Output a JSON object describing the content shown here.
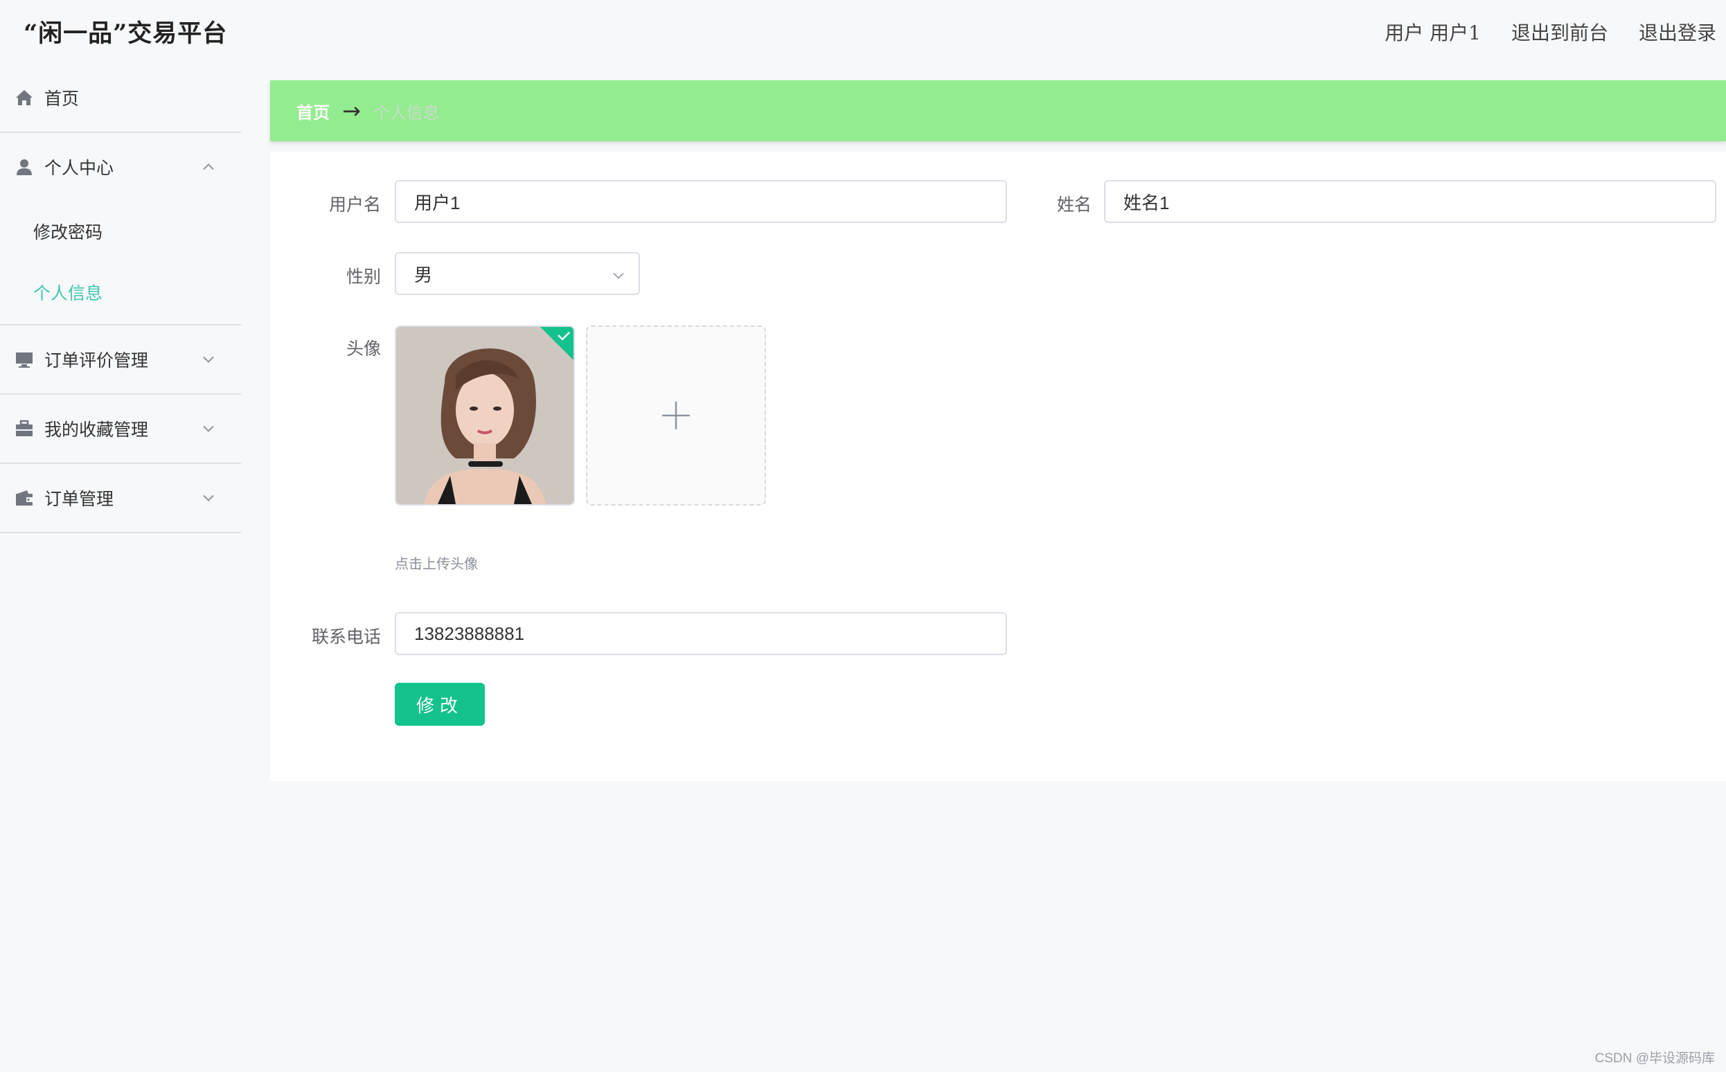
{
  "header": {
    "app_title": "“闲一品”交易平台",
    "user_prefix": "用户",
    "user_name": "用户1",
    "back_to_front": "退出到前台",
    "logout": "退出登录"
  },
  "sidebar": {
    "items": [
      {
        "label": "首页",
        "icon": "home-icon"
      },
      {
        "label": "个人中心",
        "icon": "user-icon",
        "expanded": true,
        "children": [
          {
            "label": "修改密码"
          },
          {
            "label": "个人信息",
            "active": true
          }
        ]
      },
      {
        "label": "订单评价管理",
        "icon": "monitor-icon"
      },
      {
        "label": "我的收藏管理",
        "icon": "briefcase-icon"
      },
      {
        "label": "订单管理",
        "icon": "wallet-icon"
      }
    ]
  },
  "breadcrumb": {
    "home": "首页",
    "arrow": "→",
    "current": "个人信息"
  },
  "form": {
    "username_label": "用户名",
    "username_value": "用户1",
    "name_label": "姓名",
    "name_value": "姓名1",
    "gender_label": "性别",
    "gender_value": "男",
    "avatar_label": "头像",
    "avatar_hint": "点击上传头像",
    "phone_label": "联系电话",
    "phone_value": "13823888881",
    "submit_label": "修改"
  },
  "watermark": "CSDN @毕设源码库",
  "colors": {
    "accent": "#3ec8ae",
    "breadcrumb_bg": "#93ec8f",
    "button": "#13c28c",
    "page_bg": "#f7f8fa"
  }
}
